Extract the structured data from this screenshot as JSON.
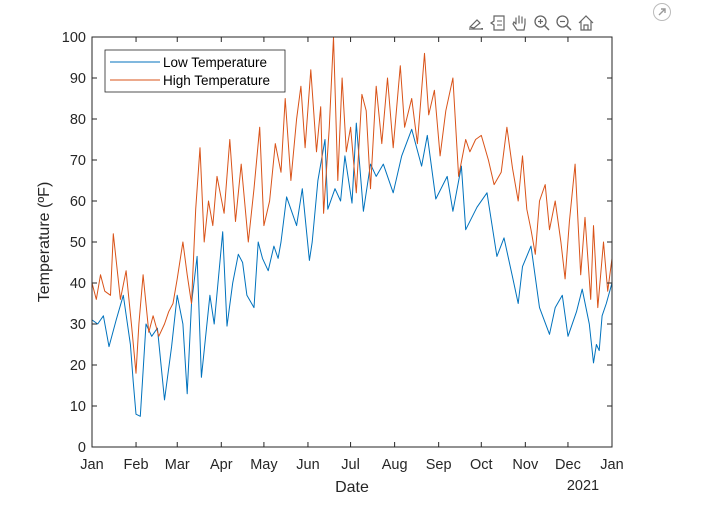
{
  "toolbar": {
    "buttons": [
      {
        "name": "brush-data-icon",
        "label": "Brush/Select Data"
      },
      {
        "name": "data-tips-icon",
        "label": "Data Tips"
      },
      {
        "name": "pan-icon",
        "label": "Pan"
      },
      {
        "name": "zoom-in-icon",
        "label": "Zoom In"
      },
      {
        "name": "zoom-out-icon",
        "label": "Zoom Out"
      },
      {
        "name": "home-icon",
        "label": "Restore View"
      }
    ],
    "export_icon": "export-arrow-icon"
  },
  "chart_data": {
    "type": "line",
    "title": "",
    "xlabel": "Date",
    "ylabel": "Temperature (ºF)",
    "xlim_days": [
      0,
      366
    ],
    "ylim": [
      0,
      100
    ],
    "x_tick_labels": [
      "Jan",
      "Feb",
      "Mar",
      "Apr",
      "May",
      "Jun",
      "Jul",
      "Aug",
      "Sep",
      "Oct",
      "Nov",
      "Dec",
      "Jan"
    ],
    "x_tick_days": [
      0,
      31,
      60,
      91,
      121,
      152,
      182,
      213,
      244,
      274,
      305,
      335,
      366
    ],
    "x_secondary_label": "2021",
    "y_ticks": [
      0,
      10,
      20,
      30,
      40,
      50,
      60,
      70,
      80,
      90,
      100
    ],
    "grid": false,
    "legend_position": "top-left",
    "series": [
      {
        "name": "Low Temperature",
        "color": "#0072BD",
        "x_days": [
          0,
          4,
          8,
          12,
          17,
          22,
          27,
          29,
          31,
          34,
          38,
          42,
          46,
          51,
          56,
          60,
          64,
          67,
          70,
          74,
          77,
          83,
          86,
          92,
          95,
          99,
          103,
          106,
          109,
          114,
          117,
          120,
          124,
          128,
          131,
          133,
          137,
          144,
          148,
          153,
          155,
          159,
          164,
          166,
          171,
          175,
          178,
          183,
          186,
          191,
          196,
          200,
          205,
          212,
          218,
          225,
          232,
          236,
          242,
          250,
          254,
          260,
          263,
          271,
          278,
          285,
          290,
          296,
          300,
          303,
          309,
          315,
          322,
          326,
          331,
          335,
          341,
          345,
          350,
          353,
          355,
          357,
          359,
          362,
          366
        ],
        "values": [
          31,
          30,
          32,
          24.5,
          31,
          37,
          25,
          16,
          8,
          7.5,
          30,
          27,
          29,
          11.5,
          24.5,
          37,
          30,
          13,
          35,
          46.5,
          17,
          37,
          30,
          52.5,
          29.5,
          40,
          47,
          45,
          37,
          34,
          50,
          46,
          43,
          49,
          46,
          50,
          61,
          54,
          63,
          45.5,
          50,
          65,
          75,
          58,
          63,
          60,
          71,
          59.5,
          79,
          57.5,
          69,
          66,
          69,
          62,
          71,
          77.5,
          68.5,
          76,
          60.5,
          66,
          57.5,
          68.5,
          53,
          58.5,
          62,
          46.5,
          51,
          41.5,
          35,
          44,
          49,
          34,
          27.5,
          34,
          37,
          27,
          33,
          38.5,
          30,
          20.5,
          25,
          23.5,
          32,
          35,
          40
        ]
      },
      {
        "name": "High Temperature",
        "color": "#D95319",
        "x_days": [
          0,
          3,
          6,
          9,
          13,
          15,
          20,
          24,
          28,
          31,
          33,
          36,
          40,
          43,
          47,
          51,
          54,
          57,
          60,
          64,
          67,
          70,
          73,
          76,
          79,
          82,
          85,
          88,
          93,
          97,
          101,
          105,
          110,
          114,
          118,
          121,
          125,
          129,
          133,
          136,
          140,
          144,
          147,
          150,
          154,
          158,
          161,
          163,
          167,
          170,
          173,
          176,
          179,
          182,
          186,
          190,
          193,
          196,
          200,
          204,
          208,
          212,
          217,
          220,
          225,
          229,
          234,
          237,
          241,
          245,
          249,
          254,
          258,
          263,
          266,
          270,
          274,
          279,
          283,
          288,
          292,
          296,
          300,
          303,
          306,
          309,
          312,
          315,
          319,
          322,
          326,
          330,
          333,
          336,
          340,
          344,
          347,
          351,
          353,
          356,
          360,
          363,
          366
        ],
        "values": [
          40,
          36,
          42,
          38,
          37,
          52,
          36,
          43,
          29,
          18,
          30,
          42,
          28,
          32,
          27,
          30,
          33,
          35,
          41,
          50,
          42,
          35,
          58,
          73,
          50,
          60,
          54,
          66,
          57,
          75,
          55,
          69,
          50,
          63,
          78,
          54,
          60,
          74,
          67,
          85,
          65,
          80,
          88,
          73,
          92,
          72,
          83,
          57,
          78,
          100,
          65,
          90,
          72,
          78,
          62,
          86,
          82,
          63,
          88,
          74,
          90,
          73,
          93,
          78,
          85,
          74,
          96,
          81,
          87,
          71,
          82,
          90,
          66,
          75,
          72,
          75,
          76,
          70,
          64,
          67,
          78,
          68,
          60,
          71,
          58,
          53,
          47,
          60,
          64,
          53,
          60,
          50,
          41,
          55,
          69,
          42,
          56,
          36,
          54,
          34,
          50,
          38,
          46
        ]
      }
    ]
  }
}
